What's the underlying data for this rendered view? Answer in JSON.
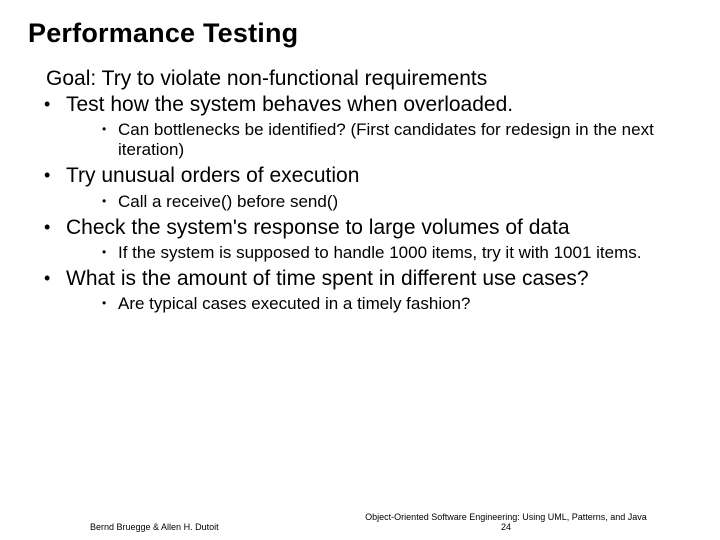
{
  "title": "Performance Testing",
  "goal": "Goal: Try to violate non-functional requirements",
  "bullets": [
    {
      "text": "Test how the system behaves when overloaded.",
      "sub": [
        "Can bottlenecks be identified?  (First candidates for redesign in the next iteration)"
      ]
    },
    {
      "text": "Try unusual orders of execution",
      "sub": [
        "Call a receive()  before send()"
      ]
    },
    {
      "text": "Check the system's response to large volumes of data",
      "sub": [
        "If the system is supposed to handle 1000 items, try it with 1001 items."
      ]
    },
    {
      "text": "What is the amount of time spent in different use cases?",
      "sub": [
        "Are typical cases executed  in a timely fashion?"
      ]
    }
  ],
  "footer": {
    "left": "Bernd Bruegge & Allen H. Dutoit",
    "right_line": "Object-Oriented Software Engineering: Using UML, Patterns, and Java",
    "page": "24"
  }
}
